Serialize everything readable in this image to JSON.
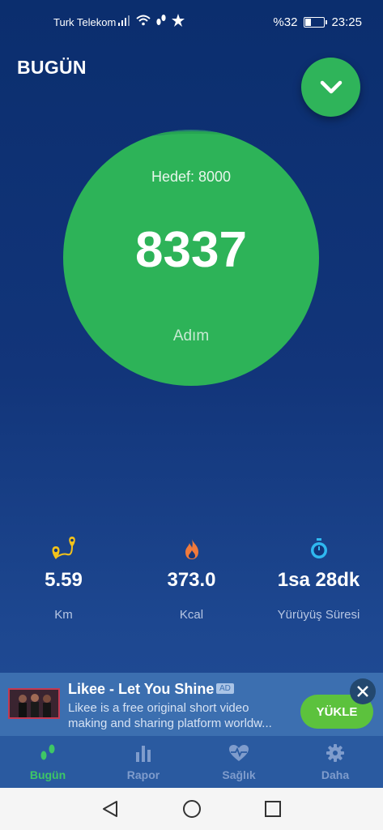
{
  "status_bar": {
    "carrier": "Turk Telekom",
    "battery_text": "%32",
    "time": "23:25"
  },
  "header": {
    "title": "BUGÜN"
  },
  "steps_circle": {
    "goal_text": "Hedef: 8000",
    "steps": "8337",
    "label": "Adım"
  },
  "stats": [
    {
      "icon": "route-icon",
      "value": "5.59",
      "label": "Km"
    },
    {
      "icon": "flame-icon",
      "value": "373.0",
      "label": "Kcal"
    },
    {
      "icon": "stopwatch-icon",
      "value": "1sa 28dk",
      "label": "Yürüyüş Süresi"
    }
  ],
  "ad": {
    "title": "Likee - Let You Shine",
    "badge": "AD",
    "description": "Likee is a free original short video making and sharing platform worldw...",
    "button": "YÜKLE"
  },
  "bottom_nav": [
    {
      "label": "Bugün",
      "icon": "footsteps-icon",
      "active": true
    },
    {
      "label": "Rapor",
      "icon": "bar-chart-icon",
      "active": false
    },
    {
      "label": "Sağlık",
      "icon": "heart-pulse-icon",
      "active": false
    },
    {
      "label": "Daha",
      "icon": "gear-icon",
      "active": false
    }
  ],
  "colors": {
    "accent_green": "#2db358",
    "background_top": "#0b2e6e",
    "background_bottom": "#244f98"
  }
}
